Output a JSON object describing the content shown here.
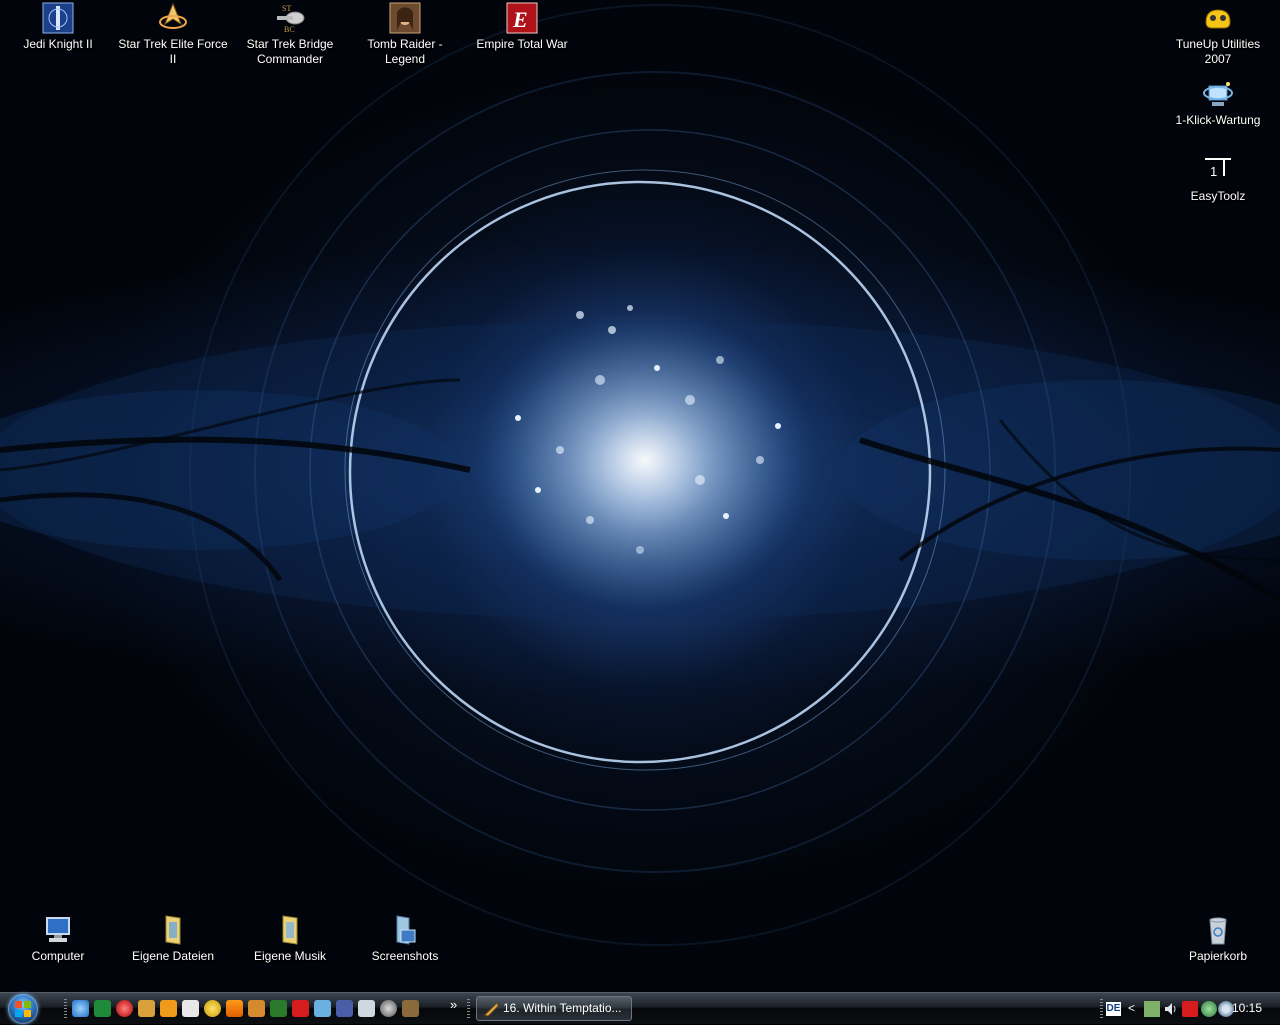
{
  "desktop_icons_top_left": [
    {
      "id": "jedi",
      "label": "Jedi Knight II",
      "icon": "jedi-knight-icon"
    },
    {
      "id": "elite",
      "label": "Star Trek Elite Force II",
      "icon": "star-trek-elite-force-icon"
    },
    {
      "id": "bridge",
      "label": "Star Trek Bridge Commander",
      "icon": "star-trek-bridge-commander-icon"
    },
    {
      "id": "tomb",
      "label": "Tomb Raider - Legend",
      "icon": "tomb-raider-icon"
    },
    {
      "id": "empire",
      "label": "Empire Total War",
      "icon": "empire-total-war-icon"
    }
  ],
  "desktop_icons_right": [
    {
      "id": "tuneup",
      "label": "TuneUp Utilities 2007",
      "icon": "tuneup-utilities-icon"
    },
    {
      "id": "oneclick",
      "label": "1-Klick-Wartung",
      "icon": "one-click-maintenance-icon"
    },
    {
      "id": "easytoolz",
      "label": "EasyToolz",
      "icon": "easytoolz-icon"
    }
  ],
  "desktop_icons_bottom": [
    {
      "id": "computer",
      "label": "Computer",
      "icon": "computer-icon"
    },
    {
      "id": "eigene-dateien",
      "label": "Eigene Dateien",
      "icon": "folder-icon"
    },
    {
      "id": "eigene-musik",
      "label": "Eigene Musik",
      "icon": "music-folder-icon"
    },
    {
      "id": "screenshots",
      "label": "Screenshots",
      "icon": "screenshots-folder-icon"
    },
    {
      "id": "papierkorb",
      "label": "Papierkorb",
      "icon": "recycle-bin-icon"
    }
  ],
  "taskbar": {
    "quicklaunch_more": "»",
    "active_task_label": "16. Within Temptatio...",
    "language_indicator": "DE",
    "tray_expand": "<",
    "clock": "10:15"
  },
  "colors": {
    "accent": "#2f7cc9",
    "taskbar": "#0c0f12",
    "wallpaper_glow": "#c8e1ff"
  }
}
